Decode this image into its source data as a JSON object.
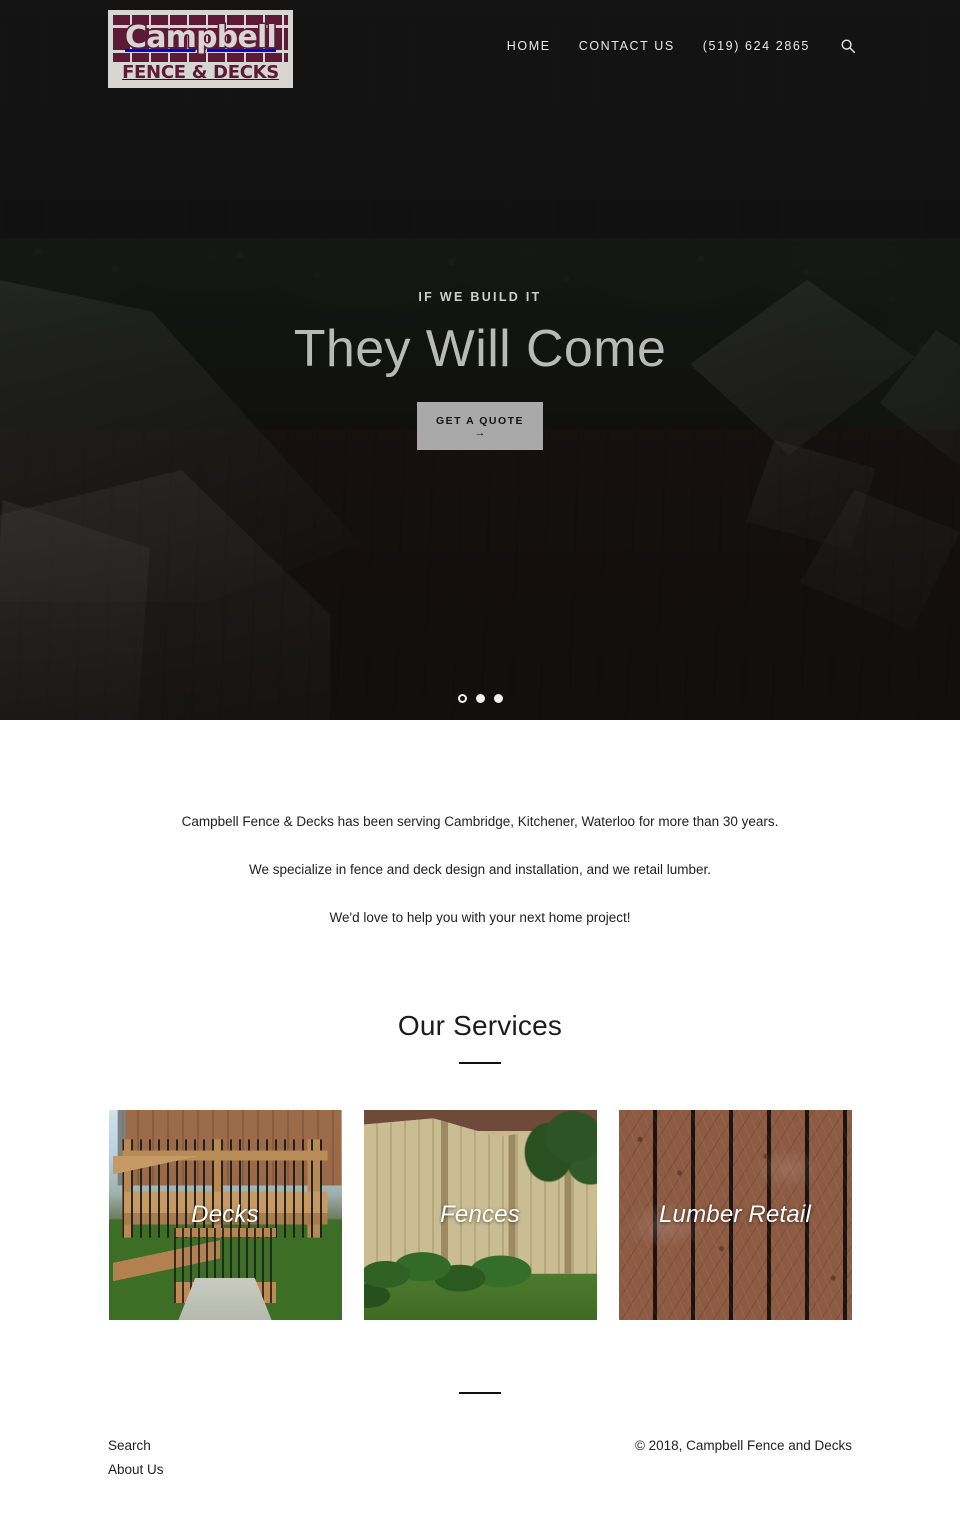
{
  "site": {
    "brand_color": "#5d1a35",
    "logo": {
      "word": "Campbell",
      "sub": "FENCE & DECKS"
    }
  },
  "header": {
    "nav": [
      {
        "label": "HOME"
      },
      {
        "label": "CONTACT US"
      },
      {
        "label": "(519) 624 2865"
      }
    ],
    "search_icon": "search-icon"
  },
  "hero": {
    "eyebrow": "IF WE BUILD IT",
    "title": "They Will Come",
    "cta_label": "GET A QUOTE",
    "cta_arrow": "→",
    "slides": [
      {
        "state": "ring"
      },
      {
        "state": "filled"
      },
      {
        "state": "filled"
      }
    ]
  },
  "intro": {
    "paragraphs": [
      "Campbell Fence & Decks has been serving Cambridge, Kitchener, Waterloo for more than 30 years.",
      "We specialize in fence and deck design and installation, and we retail lumber.",
      "We'd love to help you with your next home project!"
    ]
  },
  "services": {
    "title": "Our Services",
    "cards": [
      {
        "label": "Decks"
      },
      {
        "label": "Fences"
      },
      {
        "label": "Lumber Retail"
      }
    ]
  },
  "footer": {
    "links": [
      {
        "label": "Search"
      },
      {
        "label": "About Us"
      }
    ],
    "copyright": "© 2018, Campbell Fence and Decks"
  }
}
